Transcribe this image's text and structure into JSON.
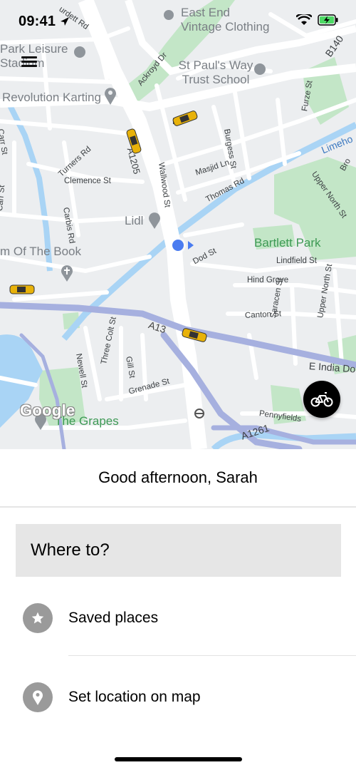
{
  "status_bar": {
    "time": "09:41"
  },
  "map": {
    "places": {
      "east_end_vintage": "East End Vintage Clothing",
      "park_leisure": "Park Leisure Stadium",
      "st_pauls_way": "St Paul's Way Trust School",
      "revolution_karting": "Revolution Karting",
      "lidl": "Lidl",
      "kingdom_of_the_book": "m Of The Book",
      "bartlett_park": "Bartlett Park",
      "the_grapes": "The Grapes"
    },
    "streets": {
      "burdett_rd": "urdett Rd",
      "ackroyd_dr": "Ackroyd Dr",
      "b140": "B140",
      "furze_st": "Furze St",
      "b": "B",
      "carr_st": "Carr St",
      "turners_rd": "Turners Rd",
      "a1205": "A1205",
      "wallwood_st": "Wallwood St",
      "burgess_st": "Burgess St",
      "masjid_ln": "Masjid Ln",
      "thomas_rd": "Thomas Rd",
      "limehouse": "Limeho",
      "upper_north_st": "Upper North St",
      "bro": "Bro",
      "clemence_st": "Clemence St",
      "carbis_rd": "Carbis Rd",
      "carr_st_2": "Carr St",
      "dod_st": "Dod St",
      "lindfield_st": "Lindfield St",
      "hind_grove": "Hind Grove",
      "canton_st": "Canton St",
      "saracen_st": "Saracen St",
      "upper_north_st_2": "Upper North St",
      "a13": "A13",
      "newell_st": "Newell St",
      "three_colt_st": "Three Colt St",
      "gill_st": "Gill St",
      "grenade_st": "Grenade St",
      "e_india_dock": "E India Do",
      "pennyfields": "Pennyfields",
      "a1261": "A1261"
    },
    "attribution": "Google"
  },
  "sheet": {
    "greeting": "Good afternoon, Sarah",
    "search_placeholder": "Where to?",
    "saved_places": "Saved places",
    "set_location": "Set location on map"
  },
  "icons": {
    "menu": "hamburger-icon",
    "bike": "bicycle-icon",
    "saved": "star-icon",
    "set_location": "map-pin-icon",
    "location": "navigation-arrow-icon"
  },
  "colors": {
    "map_bg": "#eceef0",
    "road": "#ffffff",
    "motorway": "#a9b1dc",
    "water": "#aadaff",
    "park": "#c8e6c9",
    "accent_green": "#4caf50",
    "user_dot": "#4a7cf0",
    "search_bg": "#e6e6e6"
  }
}
